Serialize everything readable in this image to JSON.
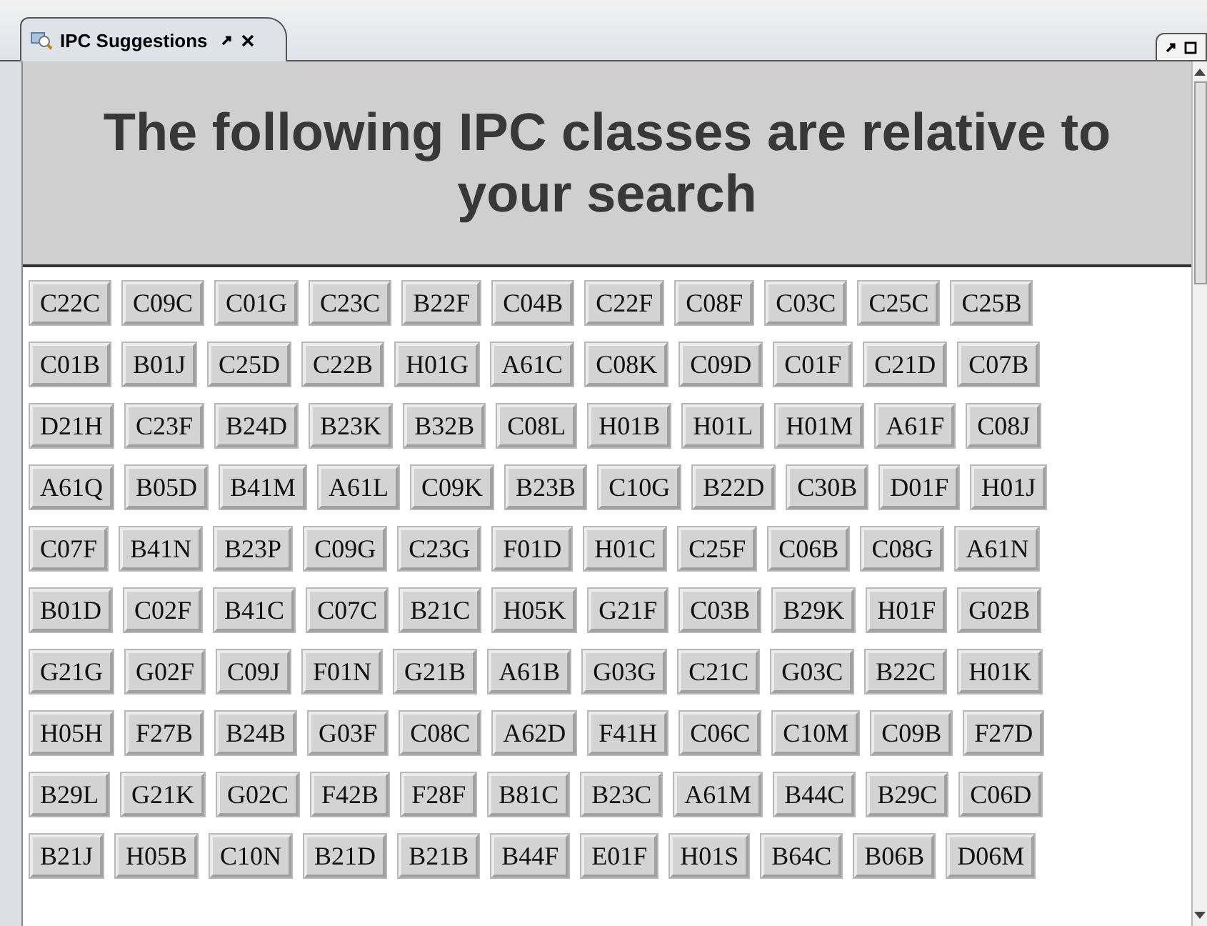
{
  "tab": {
    "title": "IPC Suggestions"
  },
  "heading": "The following IPC classes are relative to your search",
  "rows": [
    [
      "C22C",
      "C09C",
      "C01G",
      "C23C",
      "B22F",
      "C04B",
      "C22F",
      "C08F",
      "C03C",
      "C25C",
      "C25B"
    ],
    [
      "C01B",
      "B01J",
      "C25D",
      "C22B",
      "H01G",
      "A61C",
      "C08K",
      "C09D",
      "C01F",
      "C21D",
      "C07B"
    ],
    [
      "D21H",
      "C23F",
      "B24D",
      "B23K",
      "B32B",
      "C08L",
      "H01B",
      "H01L",
      "H01M",
      "A61F",
      "C08J"
    ],
    [
      "A61Q",
      "B05D",
      "B41M",
      "A61L",
      "C09K",
      "B23B",
      "C10G",
      "B22D",
      "C30B",
      "D01F",
      "H01J"
    ],
    [
      "C07F",
      "B41N",
      "B23P",
      "C09G",
      "C23G",
      "F01D",
      "H01C",
      "C25F",
      "C06B",
      "C08G",
      "A61N"
    ],
    [
      "B01D",
      "C02F",
      "B41C",
      "C07C",
      "B21C",
      "H05K",
      "G21F",
      "C03B",
      "B29K",
      "H01F",
      "G02B"
    ],
    [
      "G21G",
      "G02F",
      "C09J",
      "F01N",
      "G21B",
      "A61B",
      "G03G",
      "C21C",
      "G03C",
      "B22C",
      "H01K"
    ],
    [
      "H05H",
      "F27B",
      "B24B",
      "G03F",
      "C08C",
      "A62D",
      "F41H",
      "C06C",
      "C10M",
      "C09B",
      "F27D"
    ],
    [
      "B29L",
      "G21K",
      "G02C",
      "F42B",
      "F28F",
      "B81C",
      "B23C",
      "A61M",
      "B44C",
      "B29C",
      "C06D"
    ],
    [
      "B21J",
      "H05B",
      "C10N",
      "B21D",
      "B21B",
      "B44F",
      "E01F",
      "H01S",
      "B64C",
      "B06B",
      "D06M"
    ]
  ]
}
